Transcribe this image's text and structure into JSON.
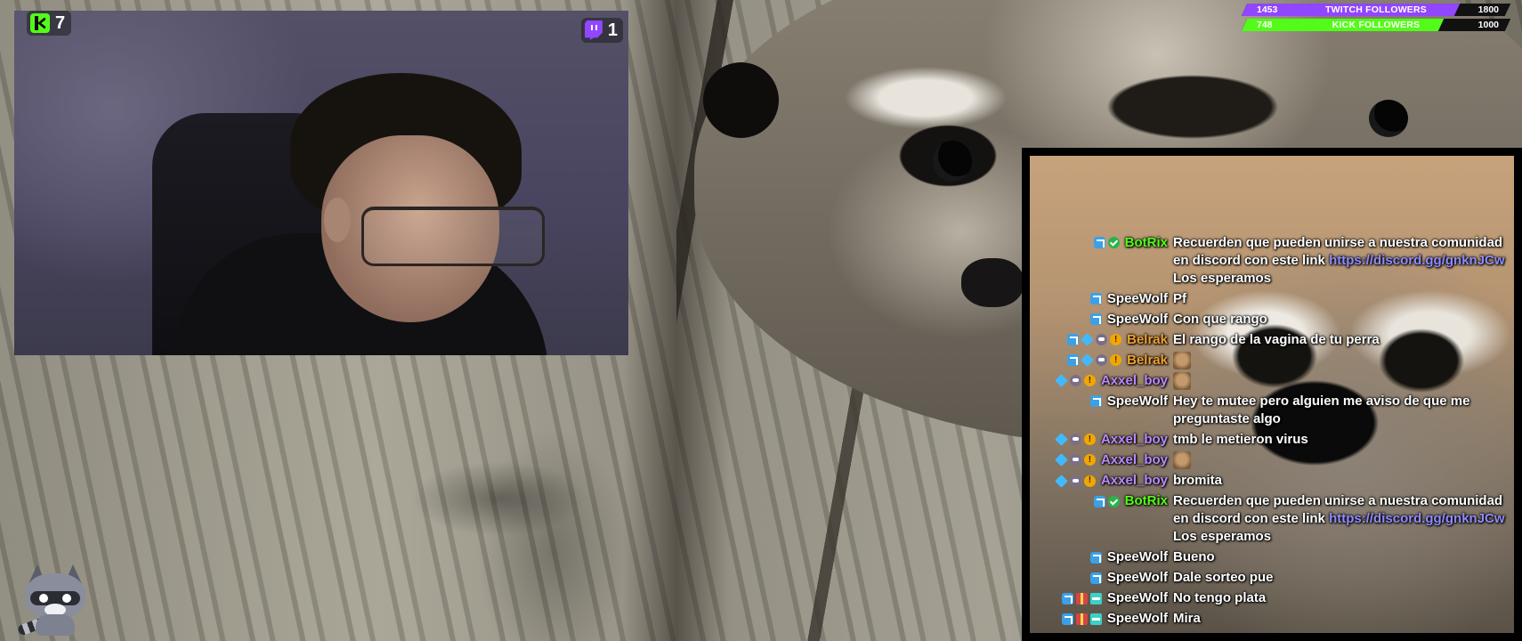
{
  "overlay": {
    "kick_counter": {
      "icon": "kick-logo-icon",
      "count": "7",
      "brand_color": "#53fc18"
    },
    "twitch_counter": {
      "icon": "twitch-logo-icon",
      "count": "1",
      "brand_color": "#9146ff"
    }
  },
  "goals": [
    {
      "current": "1453",
      "title": "TWITCH FOLLOWERS",
      "target": "1800",
      "progress": 0.807,
      "color": "#9146ff"
    },
    {
      "current": "748",
      "title": "KICK FOLLOWERS",
      "target": "1000",
      "progress": 0.748,
      "color": "#53fc18"
    }
  ],
  "chat": {
    "messages": [
      {
        "badges": [
          "mod",
          "verified"
        ],
        "user": "BotRix",
        "color": "#53fc18",
        "text": "Recuerden que pueden unirse a nuestra comunidad en discord con este link",
        "link": "https://discord.gg/gnknJCw",
        "suffix": " Los esperamos"
      },
      {
        "badges": [
          "mod"
        ],
        "user": "SpeeWolf",
        "color": "#ffffff",
        "text": "Pf"
      },
      {
        "badges": [
          "mod"
        ],
        "user": "SpeeWolf",
        "color": "#ffffff",
        "text": "Con que rango"
      },
      {
        "badges": [
          "mod",
          "vip",
          "sub",
          "og"
        ],
        "user": "Belrak",
        "color": "#f0a030",
        "text": "El rango de la vagina de tu perra"
      },
      {
        "badges": [
          "mod",
          "vip",
          "sub",
          "og"
        ],
        "user": "Belrak",
        "color": "#f0a030",
        "text": "",
        "emote": "emote-icon"
      },
      {
        "badges": [
          "vip",
          "sub",
          "og"
        ],
        "user": "Axxel_boy",
        "color": "#b98bff",
        "text": "",
        "emote": "emote-icon"
      },
      {
        "badges": [
          "mod"
        ],
        "user": "SpeeWolf",
        "color": "#ffffff",
        "text": "Hey te mutee pero alguien me aviso de que me preguntaste algo"
      },
      {
        "badges": [
          "vip",
          "sub",
          "og"
        ],
        "user": "Axxel_boy",
        "color": "#b98bff",
        "text": "tmb le metieron virus"
      },
      {
        "badges": [
          "vip",
          "sub",
          "og"
        ],
        "user": "Axxel_boy",
        "color": "#b98bff",
        "text": "",
        "emote": "emote-icon"
      },
      {
        "badges": [
          "vip",
          "sub",
          "og"
        ],
        "user": "Axxel_boy",
        "color": "#b98bff",
        "text": "bromita"
      },
      {
        "badges": [
          "mod",
          "verified"
        ],
        "user": "BotRix",
        "color": "#53fc18",
        "text": "Recuerden que pueden unirse a nuestra comunidad en discord con este link",
        "link": "https://discord.gg/gnknJCw",
        "suffix": " Los esperamos"
      },
      {
        "badges": [
          "mod"
        ],
        "user": "SpeeWolf",
        "color": "#ffffff",
        "text": "Bueno"
      },
      {
        "badges": [
          "mod"
        ],
        "user": "SpeeWolf",
        "color": "#ffffff",
        "text": "Dale sorteo pue"
      },
      {
        "badges": [
          "mod",
          "gift",
          "sword"
        ],
        "user": "SpeeWolf",
        "color": "#ffffff",
        "text": "No tengo plata"
      },
      {
        "badges": [
          "mod",
          "gift",
          "sword"
        ],
        "user": "SpeeWolf",
        "color": "#ffffff",
        "text": "Mira"
      }
    ]
  },
  "mascot": {
    "icon": "raccoon-mascot-icon"
  }
}
